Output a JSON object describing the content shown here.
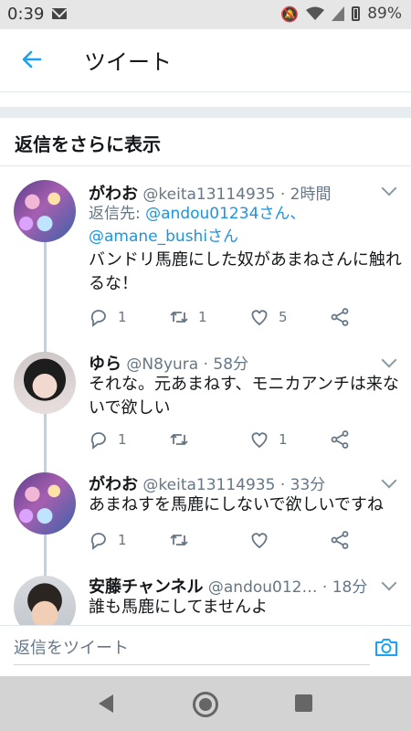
{
  "status_bar": {
    "time": "0:39",
    "battery": "89%"
  },
  "header": {
    "title": "ツイート"
  },
  "more_replies": {
    "label": "返信をさらに表示"
  },
  "tweets": [
    {
      "name": "がわお",
      "handle": "@keita13114935",
      "time": "· 2時間",
      "reply_prefix": "返信先: ",
      "reply_to_1": "@andou01234さん、",
      "reply_to_2": "@amane_bushiさん",
      "text": "バンドリ馬鹿にした奴があまねさんに触れるな！",
      "replies": "1",
      "retweets": "1",
      "likes": "5"
    },
    {
      "name": "ゆら",
      "handle": "@N8yura",
      "time": "· 58分",
      "text": "それな。元あまねす、モニカアンチは来ないで欲しい",
      "replies": "1",
      "retweets": "",
      "likes": "1"
    },
    {
      "name": "がわお",
      "handle": "@keita13114935",
      "time": "· 33分",
      "text": "あまねすを馬鹿にしないで欲しいですね",
      "replies": "1",
      "retweets": "",
      "likes": ""
    },
    {
      "name": "安藤チャンネル",
      "handle": "@andou012…",
      "time": "· 18分",
      "text": "誰も馬鹿にしてませんよ"
    }
  ],
  "reply_bar": {
    "placeholder": "返信をツイート"
  },
  "icons": {
    "back": "arrow-left-icon",
    "reply": "reply-icon",
    "retweet": "retweet-icon",
    "like": "heart-icon",
    "share": "share-icon",
    "camera": "camera-icon",
    "caret": "chevron-down-icon"
  },
  "colors": {
    "accent": "#1da1f2",
    "link": "#1b95e0",
    "muted": "#657786",
    "thread_line": "#c4cfd6"
  }
}
